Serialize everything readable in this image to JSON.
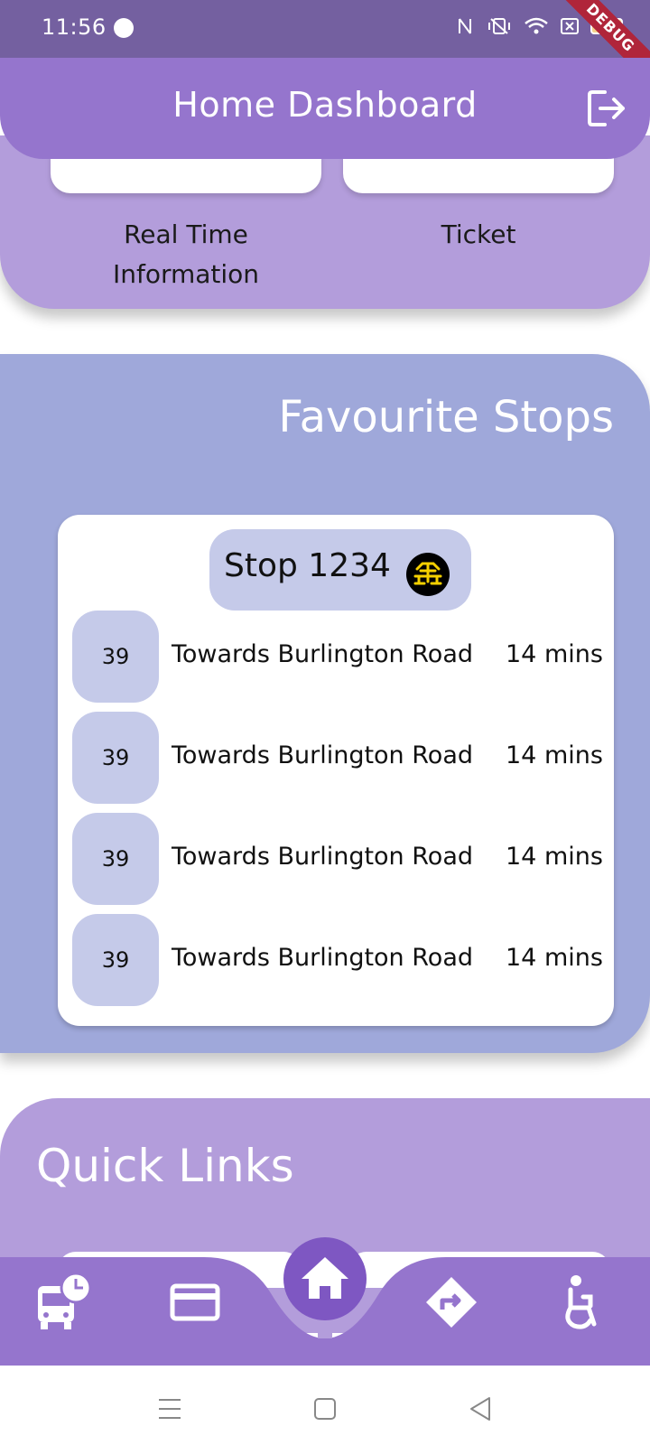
{
  "status_bar": {
    "time": "11:56",
    "battery": "94",
    "debug_label": "DEBUG"
  },
  "header": {
    "title": "Home Dashboard",
    "logout_icon": "logout-icon"
  },
  "quick_tiles": [
    {
      "label": "Real Time Information"
    },
    {
      "label": "Ticket"
    }
  ],
  "favourite_stops": {
    "title": "Favourite Stops",
    "stop": {
      "name": "Stop 1234",
      "icon": "bus-stop-icon"
    },
    "departures": [
      {
        "route": "39",
        "destination": "Towards Burlington Road",
        "eta": "14 mins"
      },
      {
        "route": "39",
        "destination": "Towards Burlington Road",
        "eta": "14 mins"
      },
      {
        "route": "39",
        "destination": "Towards Burlington Road",
        "eta": "14 mins"
      },
      {
        "route": "39",
        "destination": "Towards Burlington Road",
        "eta": "14 mins"
      }
    ]
  },
  "quick_links": {
    "title": "Quick Links"
  },
  "bottom_nav": [
    {
      "icon": "bus-schedule-icon"
    },
    {
      "icon": "card-icon"
    },
    {
      "icon": "home-icon"
    },
    {
      "icon": "directions-icon"
    },
    {
      "icon": "accessibility-icon"
    }
  ],
  "colors": {
    "header": "#9575cd",
    "favourites_bg": "#9fa8da",
    "chip": "#c5cae9",
    "quick_links_bg": "#b39ddb",
    "nav_bg": "#9575cd",
    "home_button": "#7e57c2"
  }
}
